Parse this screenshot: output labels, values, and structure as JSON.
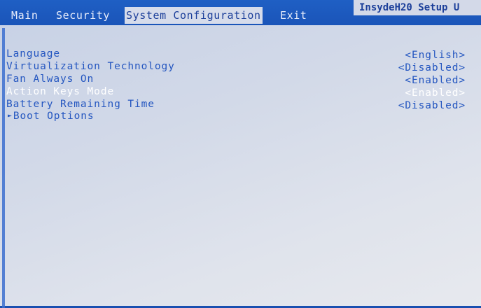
{
  "menu": {
    "tabs": [
      {
        "label": "Main"
      },
      {
        "label": "Security"
      },
      {
        "label": "System Configuration"
      },
      {
        "label": "Exit"
      }
    ],
    "active_tab": "System Configuration",
    "brand": "InsydeH20 Setup U"
  },
  "settings": [
    {
      "label": "Language",
      "value": "<English>"
    },
    {
      "label": "Virtualization Technology",
      "value": "<Disabled>"
    },
    {
      "label": "Fan Always On",
      "value": "<Enabled>"
    },
    {
      "label": "Action Keys Mode",
      "value": "<Enabled>",
      "selected": true
    },
    {
      "label": "Battery Remaining Time",
      "value": "<Disabled>"
    },
    {
      "label": "Boot Options",
      "submenu": true
    }
  ],
  "colors": {
    "menubar": "#1a54b8",
    "active_tab_bg": "#d6dceb",
    "text": "#2456c0",
    "selected_text": "#ffffff"
  }
}
